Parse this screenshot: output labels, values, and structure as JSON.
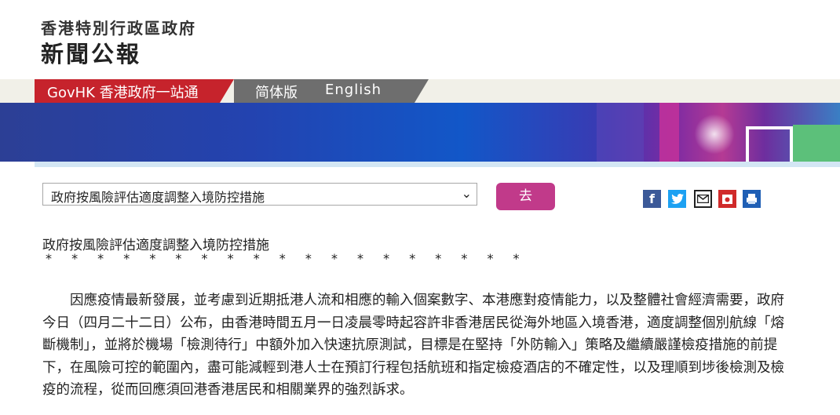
{
  "header": {
    "org_name": "香港特別行政區政府",
    "bulletin_name": "新聞公報"
  },
  "nav": {
    "govhk_label": "GovHK 香港政府一站通",
    "simplified_label": "简体版",
    "english_label": "English"
  },
  "colors": {
    "nav_red": "#c6232c",
    "nav_gray": "#6e6e6e",
    "go_button": "#c13a8a"
  },
  "toolbar": {
    "select_value": "政府按風險評估適度調整入境防控措施",
    "go_label": "去",
    "share_icons": [
      "facebook-icon",
      "twitter-icon",
      "email-icon",
      "weibo-icon",
      "print-icon"
    ]
  },
  "article": {
    "title": "政府按風險評估適度調整入境防控措施",
    "stars": "* * * * * * * * * * * * * * * * * * *",
    "paragraph": "因應疫情最新發展，並考慮到近期抵港人流和相應的輸入個案數字、本港應對疫情能力，以及整體社會經濟需要，政府今日（四月二十二日）公布，由香港時間五月一日凌晨零時起容許非香港居民從海外地區入境香港，適度調整個別航線「熔斷機制」，並將於機場「檢測待行」中額外加入快速抗原測試，目標是在堅持「外防輸入」策略及繼續嚴謹檢疫措施的前提下，在風險可控的範圍內，盡可能減輕到港人士在預訂行程包括航班和指定檢疫酒店的不確定性，以及理順到埗後檢測及檢疫的流程，從而回應須回港香港居民和相關業界的強烈訴求。"
  }
}
